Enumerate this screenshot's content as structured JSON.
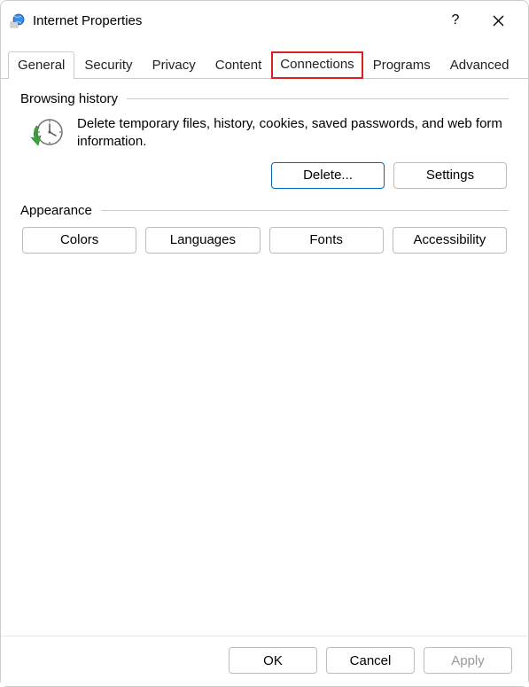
{
  "window": {
    "title": "Internet Properties"
  },
  "tabs": {
    "general": "General",
    "security": "Security",
    "privacy": "Privacy",
    "content": "Content",
    "connections": "Connections",
    "programs": "Programs",
    "advanced": "Advanced",
    "active": "General",
    "highlighted": "Connections"
  },
  "browsing": {
    "group_label": "Browsing history",
    "description": "Delete temporary files, history, cookies, saved passwords, and web form information.",
    "delete_label": "Delete...",
    "settings_label": "Settings"
  },
  "appearance": {
    "group_label": "Appearance",
    "colors_label": "Colors",
    "languages_label": "Languages",
    "fonts_label": "Fonts",
    "accessibility_label": "Accessibility"
  },
  "actions": {
    "ok": "OK",
    "cancel": "Cancel",
    "apply": "Apply"
  }
}
